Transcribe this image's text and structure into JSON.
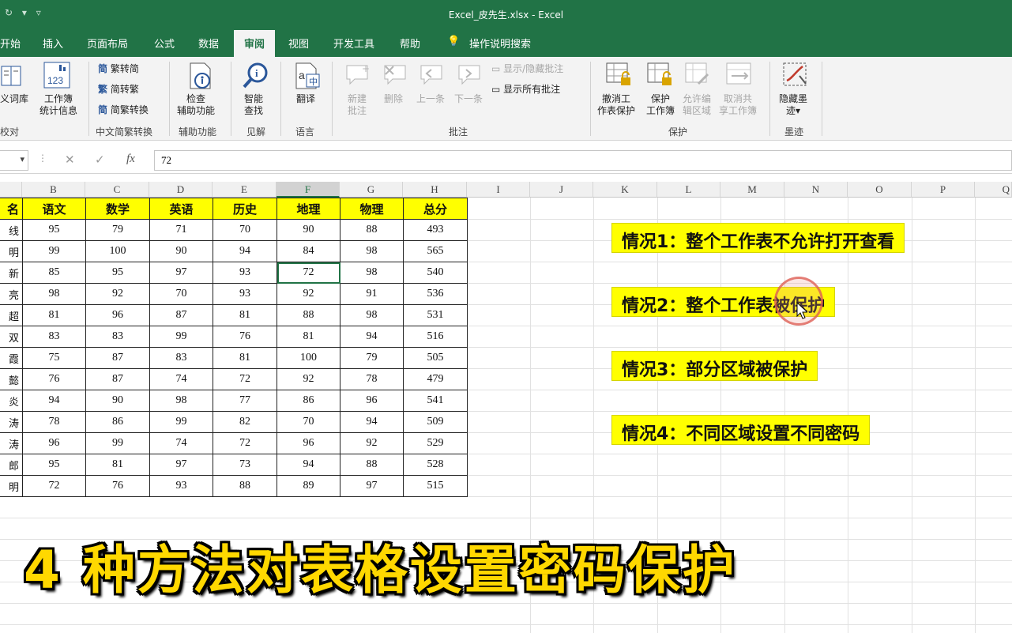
{
  "title_bar": {
    "title": "Excel_皮先生.xlsx  -  Excel"
  },
  "tabs": [
    {
      "label": "开始"
    },
    {
      "label": "插入"
    },
    {
      "label": "页面布局"
    },
    {
      "label": "公式"
    },
    {
      "label": "数据"
    },
    {
      "label": "审阅",
      "active": true
    },
    {
      "label": "视图"
    },
    {
      "label": "开发工具"
    },
    {
      "label": "帮助"
    }
  ],
  "tell_me": "操作说明搜索",
  "ribbon": {
    "proofing": {
      "thesaurus": "义词库",
      "stats_l1": "工作簿",
      "stats_l2": "统计信息",
      "group": "校对"
    },
    "chinese": {
      "t2s": "繁转简",
      "s2t": "简转繁",
      "convert": "简繁转换",
      "group": "中文简繁转换"
    },
    "access": {
      "l1": "检查",
      "l2": "辅助功能",
      "group": "辅助功能"
    },
    "insights": {
      "l1": "智能",
      "l2": "查找",
      "group": "见解"
    },
    "language": {
      "translate": "翻译",
      "group": "语言"
    },
    "comments": {
      "new_l1": "新建",
      "new_l2": "批注",
      "delete": "删除",
      "prev": "上一条",
      "next": "下一条",
      "show_hide": "显示/隐藏批注",
      "show_all": "显示所有批注",
      "group": "批注"
    },
    "protect": {
      "unprotect_l1": "撤消工",
      "unprotect_l2": "作表保护",
      "wb_l1": "保护",
      "wb_l2": "工作簿",
      "allow_l1": "允许编",
      "allow_l2": "辑区域",
      "unshare_l1": "取消共",
      "unshare_l2": "享工作簿",
      "group": "保护"
    },
    "ink": {
      "hide_l1": "隐藏墨",
      "hide_l2": "迹",
      "group": "墨迹"
    }
  },
  "formula_bar": {
    "value": "72",
    "fx": "fx"
  },
  "columns": [
    "B",
    "C",
    "D",
    "E",
    "F",
    "G",
    "H",
    "I",
    "J",
    "K",
    "L",
    "M",
    "N",
    "O",
    "P",
    "Q"
  ],
  "table": {
    "headers": [
      "名",
      "语文",
      "数学",
      "英语",
      "历史",
      "地理",
      "物理",
      "总分"
    ],
    "rows": [
      [
        "线",
        "95",
        "79",
        "71",
        "70",
        "90",
        "88",
        "493"
      ],
      [
        "明",
        "99",
        "100",
        "90",
        "94",
        "84",
        "98",
        "565"
      ],
      [
        "新",
        "85",
        "95",
        "97",
        "93",
        "72",
        "98",
        "540"
      ],
      [
        "亮",
        "98",
        "92",
        "70",
        "93",
        "92",
        "91",
        "536"
      ],
      [
        "超",
        "81",
        "96",
        "87",
        "81",
        "88",
        "98",
        "531"
      ],
      [
        "双",
        "83",
        "83",
        "99",
        "76",
        "81",
        "94",
        "516"
      ],
      [
        "霞",
        "75",
        "87",
        "83",
        "81",
        "100",
        "79",
        "505"
      ],
      [
        "懿",
        "76",
        "87",
        "74",
        "72",
        "92",
        "78",
        "479"
      ],
      [
        "炎",
        "94",
        "90",
        "98",
        "77",
        "86",
        "96",
        "541"
      ],
      [
        "涛",
        "78",
        "86",
        "99",
        "82",
        "70",
        "94",
        "509"
      ],
      [
        "涛",
        "96",
        "99",
        "74",
        "72",
        "96",
        "92",
        "529"
      ],
      [
        "郎",
        "95",
        "81",
        "97",
        "73",
        "94",
        "88",
        "528"
      ],
      [
        "明",
        "72",
        "76",
        "93",
        "88",
        "89",
        "97",
        "515"
      ]
    ]
  },
  "cases": [
    {
      "text": "情况1：整个工作表不允许打开查看"
    },
    {
      "text": "情况2：整个工作表被保护"
    },
    {
      "text": "情况3：部分区域被保护"
    },
    {
      "text": "情况4：不同区域设置不同密码"
    }
  ],
  "overlay_title": "4 种方法对表格设置密码保护",
  "colors": {
    "excel_green": "#217346",
    "header_yellow": "#ffff00",
    "overlay_yellow": "#ffd800"
  }
}
